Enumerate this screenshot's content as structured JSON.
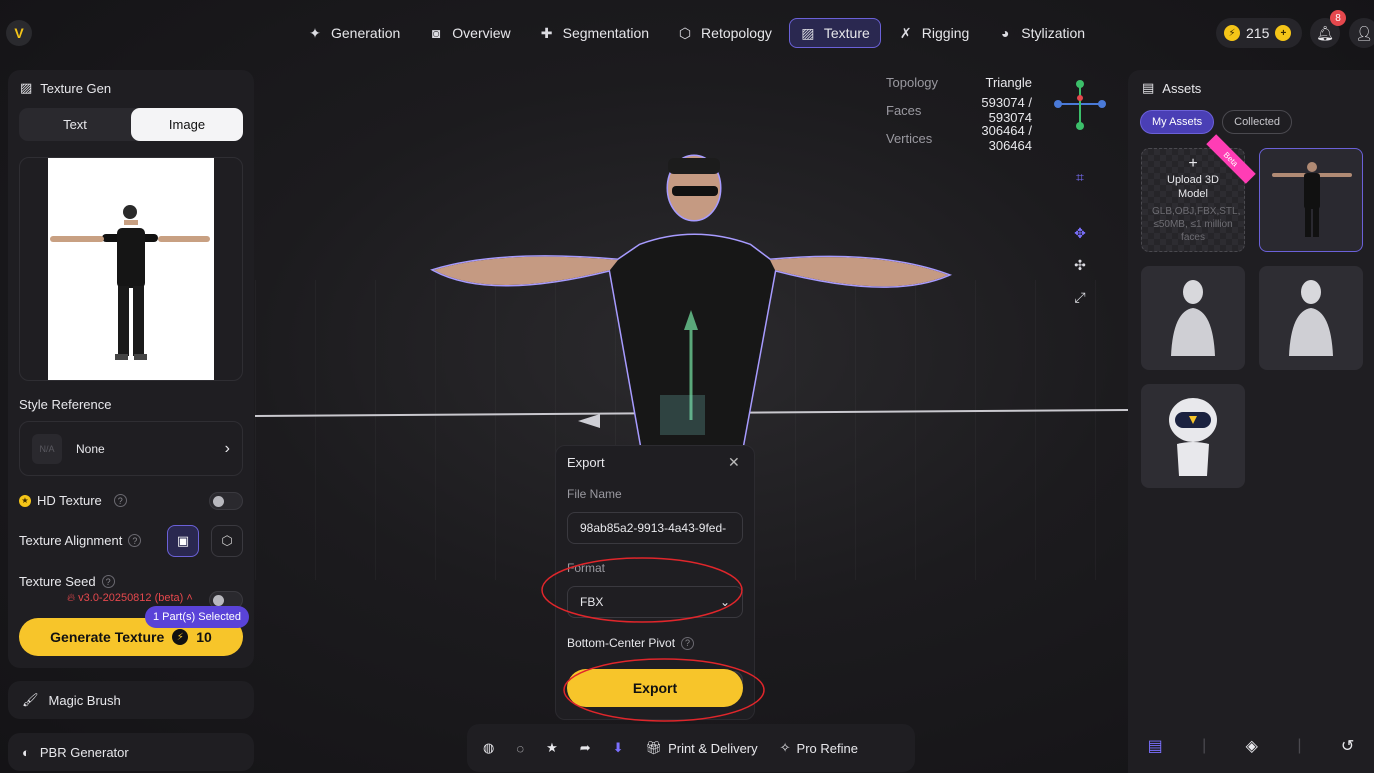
{
  "nav": {
    "items": [
      {
        "label": "Generation",
        "icon": "sparkle-icon"
      },
      {
        "label": "Overview",
        "icon": "camera-icon"
      },
      {
        "label": "Segmentation",
        "icon": "puzzle-icon"
      },
      {
        "label": "Retopology",
        "icon": "cube-icon"
      },
      {
        "label": "Texture",
        "icon": "texture-icon",
        "active": true
      },
      {
        "label": "Rigging",
        "icon": "figure-icon"
      },
      {
        "label": "Stylization",
        "icon": "palette-icon"
      }
    ],
    "credits": "215",
    "notifications": "8"
  },
  "left": {
    "title": "Texture Gen",
    "tabs": [
      "Text",
      "Image"
    ],
    "active_tab": "Image",
    "style_reference_label": "Style Reference",
    "style_reference_placeholder": "N/A",
    "style_reference_value": "None",
    "hd_texture_label": "HD Texture",
    "texture_alignment_label": "Texture Alignment",
    "texture_seed_label": "Texture Seed",
    "version": "v3.0-20250812 (beta)",
    "parts_badge": "1 Part(s) Selected",
    "generate_label": "Generate Texture",
    "generate_cost": "10",
    "magic_brush_label": "Magic Brush",
    "pbr_label": "PBR Generator"
  },
  "stats": {
    "topology_label": "Topology",
    "topology_value": "Triangle",
    "faces_label": "Faces",
    "faces_value": "593074 / 593074",
    "vertices_label": "Vertices",
    "vertices_value": "306464 / 306464"
  },
  "export": {
    "title": "Export",
    "file_name_label": "File Name",
    "file_name_value": "98ab85a2-9913-4a43-9fed-",
    "format_label": "Format",
    "format_value": "FBX",
    "pivot_label": "Bottom-Center Pivot",
    "export_label": "Export"
  },
  "toolbar": {
    "print_label": "Print & Delivery",
    "pro_refine_label": "Pro Refine"
  },
  "assets": {
    "title": "Assets",
    "tabs": [
      "My Assets",
      "Collected"
    ],
    "upload_title": "Upload 3D Model",
    "upload_hint": "GLB,OBJ,FBX,STL, ≤50MB, ≤1 million faces",
    "beta_label": "Beta"
  },
  "colors": {
    "accent": "#f7c52a",
    "purple": "#6b61d8",
    "annotation": "#e0262b"
  }
}
